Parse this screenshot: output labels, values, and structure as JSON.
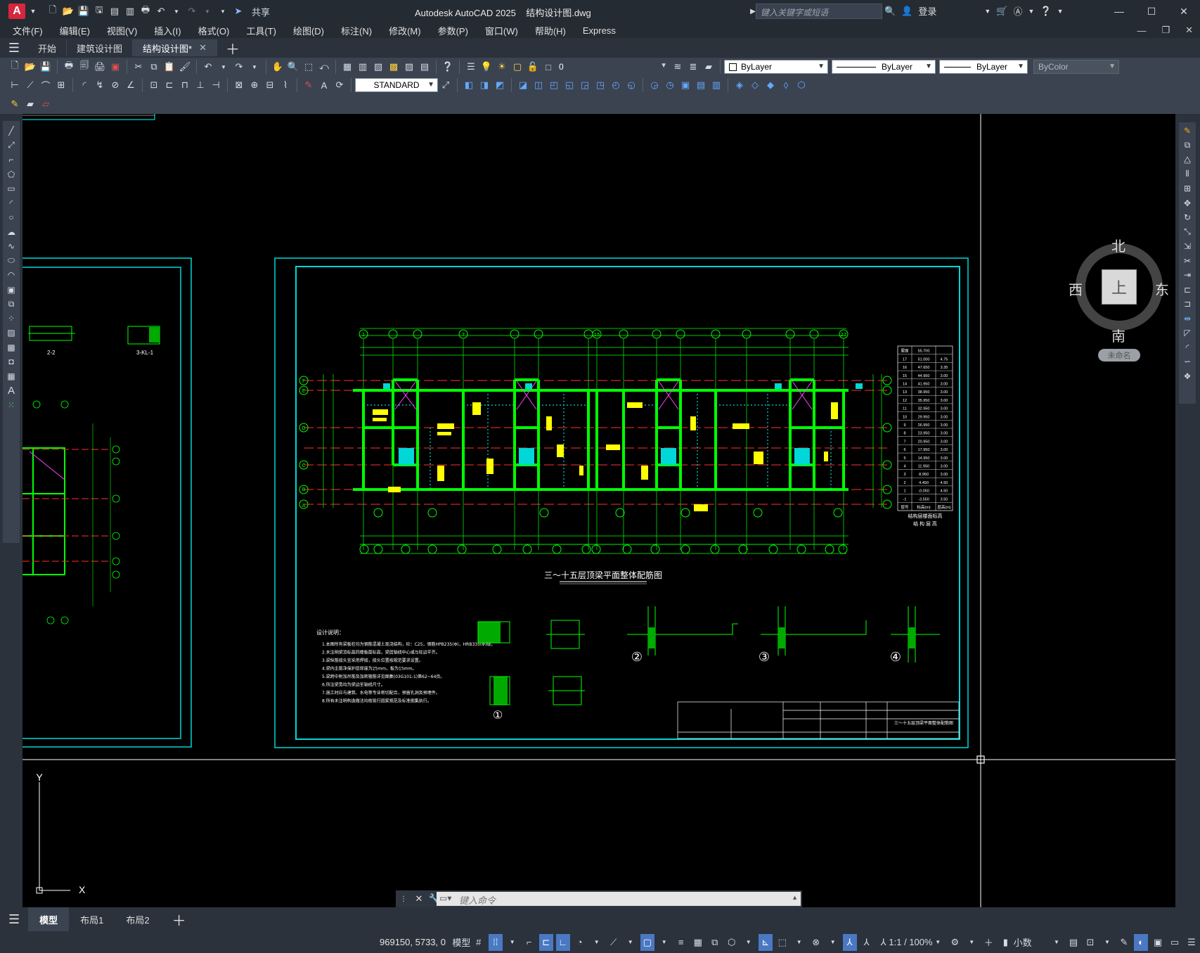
{
  "titlebar": {
    "app_letter": "A",
    "share_label": "共享",
    "app_title": "Autodesk AutoCAD 2025",
    "file_name": "结构设计图.dwg",
    "search_placeholder": "键入关键字或短语",
    "login_label": "登录"
  },
  "menubar": {
    "items": [
      "文件(F)",
      "编辑(E)",
      "视图(V)",
      "插入(I)",
      "格式(O)",
      "工具(T)",
      "绘图(D)",
      "标注(N)",
      "修改(M)",
      "参数(P)",
      "窗口(W)",
      "帮助(H)",
      "Express"
    ]
  },
  "tabs": {
    "items": [
      {
        "label": "开始"
      },
      {
        "label": "建筑设计图"
      },
      {
        "label": "结构设计图*"
      }
    ]
  },
  "properties": {
    "layer_value": "0",
    "color_value": "ByLayer",
    "linetype_value": "ByLayer",
    "lineweight_value": "ByLayer",
    "plotstyle_value": "ByColor",
    "textstyle_value": "STANDARD"
  },
  "viewcube": {
    "north": "北",
    "south": "南",
    "east": "东",
    "west": "西",
    "top_face": "上",
    "wcs_label": "未命名"
  },
  "drawing": {
    "main_title": "三～十五层顶梁平面整体配筋图",
    "notes_title": "设计说明：",
    "notes": [
      "1.本图所有梁板柱均为钢筋混凝土现浇结构，砼：C25，钢筋HPB235(Φ)，HRB335(Φ)级。",
      "2.未注明梁顶标高同楼板面标高，梁居轴线中心或与柱边平齐。",
      "3.梁纵筋接头宜采用焊接，接头位置按规范要求设置。",
      "4.梁内主筋净保护层厚度为25mm，板为15mm。",
      "5.梁跨中附加吊筋及加密箍筋详见图集(03G101-1)第62~64页。",
      "6.所注梁宽均为梁边至轴线尺寸。",
      "7.施工时应与建筑、水电等专业密切配合，预留孔洞及预埋件。",
      "8.所有未注明构造做法均按现行国家规范及标准图集执行。"
    ],
    "table_title": "结构层楼面标高",
    "table_subtitle": "结 构 层 高",
    "table_head": [
      "层号",
      "标高(m)",
      "层高(m)"
    ],
    "table_rows": [
      [
        "屋面",
        "55.700",
        ""
      ],
      [
        "17",
        "51.000",
        "4.75"
      ],
      [
        "16",
        "47.650",
        "3.35"
      ],
      [
        "15",
        "44.950",
        "3.00"
      ],
      [
        "14",
        "41.950",
        "3.00"
      ],
      [
        "13",
        "38.950",
        "3.00"
      ],
      [
        "12",
        "35.950",
        "3.00"
      ],
      [
        "11",
        "32.950",
        "3.00"
      ],
      [
        "10",
        "29.950",
        "3.00"
      ],
      [
        "9",
        "26.950",
        "3.00"
      ],
      [
        "8",
        "23.950",
        "3.00"
      ],
      [
        "7",
        "20.950",
        "3.00"
      ],
      [
        "6",
        "17.950",
        "3.00"
      ],
      [
        "5",
        "14.950",
        "3.00"
      ],
      [
        "4",
        "11.950",
        "3.00"
      ],
      [
        "3",
        "8.950",
        "3.00"
      ],
      [
        "2",
        "4.450",
        "4.50"
      ],
      [
        "1",
        "-0.050",
        "4.50"
      ],
      [
        "-1",
        "-3.550",
        "3.50"
      ]
    ],
    "section_labels": [
      "①",
      "②",
      "③",
      "④"
    ],
    "left_section_labels": [
      "2-2",
      "3-KL-1"
    ],
    "title_block_name": "三～十五层顶梁平面整体配筋图",
    "axis_x": [
      "1",
      "2",
      "4",
      "6",
      "7",
      "9",
      "11",
      "13",
      "15",
      "17",
      "19",
      "21",
      "22",
      "25",
      "27"
    ],
    "axis_y": [
      "A",
      "B",
      "C",
      "D",
      "E",
      "F"
    ]
  },
  "command": {
    "placeholder": "键入命令"
  },
  "layouts": {
    "items": [
      "模型",
      "布局1",
      "布局2"
    ]
  },
  "status": {
    "coords": "969150, 5733, 0",
    "model": "模型",
    "scale": "1:1 / 100%",
    "units": "小数"
  },
  "colors": {
    "canvas": "#000000",
    "frame_cyan": "#00d7d7",
    "wall_green": "#00ff00",
    "axis_red": "#ff3030",
    "text_yellow": "#ffff00",
    "accent_blue": "#4a78c2"
  }
}
